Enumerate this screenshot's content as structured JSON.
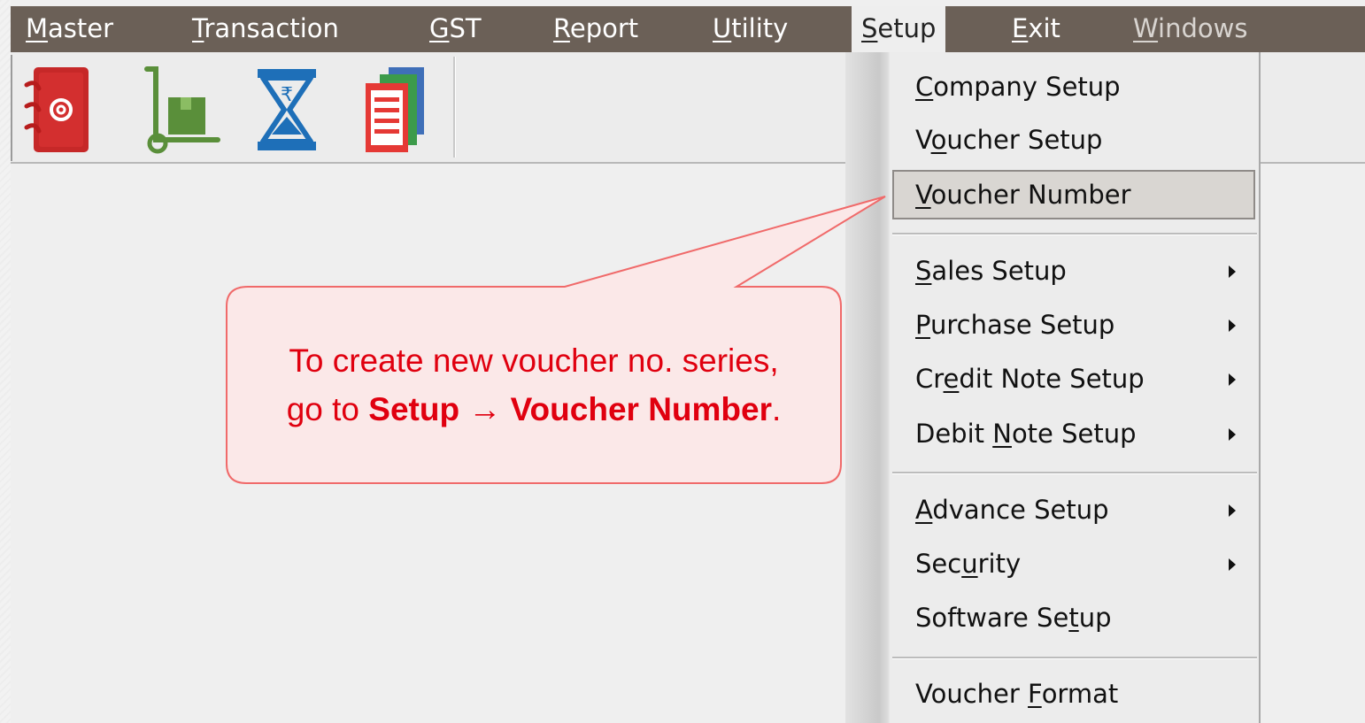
{
  "menubar": {
    "items": [
      {
        "before": "",
        "mnemonic": "M",
        "after": "aster"
      },
      {
        "before": "",
        "mnemonic": "T",
        "after": "ransaction"
      },
      {
        "before": "",
        "mnemonic": "G",
        "after": "ST"
      },
      {
        "before": "",
        "mnemonic": "R",
        "after": "eport"
      },
      {
        "before": "",
        "mnemonic": "U",
        "after": "tility"
      },
      {
        "before": "",
        "mnemonic": "S",
        "after": "etup"
      },
      {
        "before": "",
        "mnemonic": "E",
        "after": "xit"
      },
      {
        "before": "",
        "mnemonic": "W",
        "after": "indows"
      }
    ]
  },
  "toolbar": {
    "buttons": [
      "contact-book-icon",
      "hand-truck-icon",
      "rupee-hourglass-icon",
      "documents-stack-icon"
    ]
  },
  "setup_menu": {
    "items": [
      {
        "before": "",
        "mnemonic": "C",
        "after": "ompany Setup"
      },
      {
        "before": "V",
        "mnemonic": "o",
        "after": "ucher Setup"
      },
      {
        "before": "",
        "mnemonic": "V",
        "after": "oucher Number"
      },
      {
        "before": "",
        "mnemonic": "S",
        "after": "ales Setup"
      },
      {
        "before": "",
        "mnemonic": "P",
        "after": "urchase Setup"
      },
      {
        "before": "Cr",
        "mnemonic": "e",
        "after": "dit Note Setup"
      },
      {
        "before": "Debit ",
        "mnemonic": "N",
        "after": "ote Setup"
      },
      {
        "before": "",
        "mnemonic": "A",
        "after": "dvance Setup"
      },
      {
        "before": "Sec",
        "mnemonic": "u",
        "after": "rity"
      },
      {
        "before": "Software Se",
        "mnemonic": "t",
        "after": "up"
      },
      {
        "before": "Voucher ",
        "mnemonic": "F",
        "after": "ormat"
      }
    ]
  },
  "callout": {
    "line1": "To create new voucher no. series,",
    "line2_prefix": "go to ",
    "line2_bold_a": "Setup",
    "line2_arrow": "→",
    "line2_bold_b": "Voucher Number",
    "line2_suffix": "."
  },
  "colors": {
    "menubar": "#6b6057",
    "callout_fill": "#fbe8e8",
    "callout_border": "#f06a6a",
    "callout_text": "#e0000f"
  }
}
